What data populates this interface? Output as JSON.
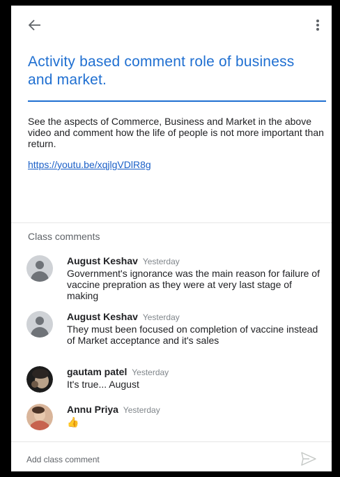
{
  "header": {
    "back_icon": "arrow-back-icon",
    "more_icon": "more-vert-icon"
  },
  "post": {
    "title": "Activity based comment role of business and market.",
    "description": "See the aspects of Commerce, Business and Market in the above video and comment how the life of people is not more important than return.",
    "link": "https://youtu.be/xqjlgVDlR8g"
  },
  "comments_section": {
    "label": "Class comments",
    "items": [
      {
        "author": "August Keshav",
        "time": "Yesterday",
        "text": "Government's ignorance was the main reason for failure of vaccine prepration as they were  at  very last stage of making"
      },
      {
        "author": "August Keshav",
        "time": "Yesterday",
        "text": "They must been focused on completion of vaccine instead of Market acceptance and it's sales"
      },
      {
        "author": "gautam patel",
        "time": "Yesterday",
        "text": "It's true... August"
      },
      {
        "author": "Annu Priya",
        "time": "Yesterday",
        "text": "👍"
      }
    ]
  },
  "composer": {
    "placeholder": "Add class comment",
    "send_icon": "send-icon"
  },
  "colors": {
    "accent": "#1f6fd1",
    "link": "#1a5fc7"
  }
}
